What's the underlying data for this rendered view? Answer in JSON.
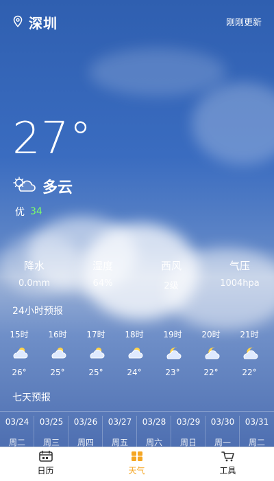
{
  "top": {
    "location": "深圳",
    "update_text": "刚刚更新"
  },
  "current": {
    "temperature": "27°",
    "condition": "多云",
    "aqi_label": "优",
    "aqi_value": "34"
  },
  "stats": [
    {
      "label": "降水",
      "value": "0.0mm"
    },
    {
      "label": "湿度",
      "value": "64%"
    },
    {
      "label": "西风",
      "value": "2级"
    },
    {
      "label": "气压",
      "value": "1004hpa"
    }
  ],
  "sections": {
    "hourly_title": "24小时预报",
    "daily_title": "七天预报"
  },
  "hourly": [
    {
      "time": "15时",
      "temp": "26°",
      "icon": "partly-cloudy-day-icon"
    },
    {
      "time": "16时",
      "temp": "25°",
      "icon": "partly-cloudy-day-icon"
    },
    {
      "time": "17时",
      "temp": "25°",
      "icon": "partly-cloudy-day-icon"
    },
    {
      "time": "18时",
      "temp": "24°",
      "icon": "partly-cloudy-day-icon"
    },
    {
      "time": "19时",
      "temp": "23°",
      "icon": "partly-cloudy-night-icon"
    },
    {
      "time": "20时",
      "temp": "22°",
      "icon": "partly-cloudy-night-icon"
    },
    {
      "time": "21时",
      "temp": "22°",
      "icon": "partly-cloudy-night-icon"
    }
  ],
  "daily": [
    {
      "date": "03/24",
      "weekday": "周二"
    },
    {
      "date": "03/25",
      "weekday": "周三"
    },
    {
      "date": "03/26",
      "weekday": "周四"
    },
    {
      "date": "03/27",
      "weekday": "周五"
    },
    {
      "date": "03/28",
      "weekday": "周六"
    },
    {
      "date": "03/29",
      "weekday": "周日"
    },
    {
      "date": "03/30",
      "weekday": "周一"
    },
    {
      "date": "03/31",
      "weekday": "周二"
    }
  ],
  "nav": [
    {
      "label": "日历",
      "icon": "calendar-icon"
    },
    {
      "label": "天气",
      "icon": "weather-grid-icon"
    },
    {
      "label": "工具",
      "icon": "cart-icon"
    }
  ],
  "colors": {
    "aqi_good": "#7cff6a",
    "nav_active": "#f5a623"
  }
}
